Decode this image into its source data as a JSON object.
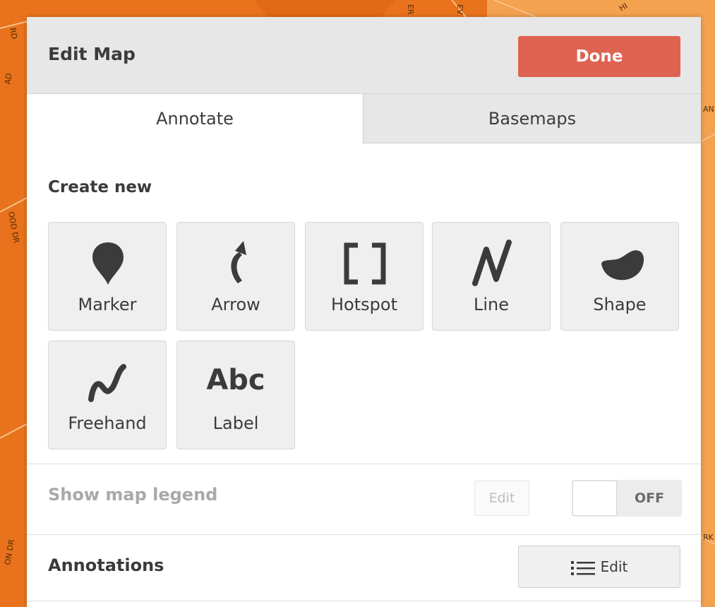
{
  "panel": {
    "title": "Edit Map",
    "done_label": "Done"
  },
  "tabs": [
    {
      "label": "Annotate",
      "active": true
    },
    {
      "label": "Basemaps",
      "active": false
    }
  ],
  "create_new": {
    "heading": "Create new",
    "tools": [
      {
        "label": "Marker",
        "icon": "marker-icon"
      },
      {
        "label": "Arrow",
        "icon": "arrow-icon"
      },
      {
        "label": "Hotspot",
        "icon": "hotspot-icon"
      },
      {
        "label": "Line",
        "icon": "line-icon"
      },
      {
        "label": "Shape",
        "icon": "shape-icon"
      },
      {
        "label": "Freehand",
        "icon": "freehand-icon"
      },
      {
        "label": "Label",
        "icon": "abc-icon",
        "icon_text": "Abc"
      }
    ]
  },
  "legend": {
    "label": "Show map legend",
    "edit_label": "Edit",
    "toggle_state": "OFF"
  },
  "annotations": {
    "label": "Annotations",
    "edit_label": "Edit",
    "edit_icon": "list-icon"
  },
  "map_labels": [
    "RD",
    "AD",
    "OOD DR",
    "ER",
    "EV",
    "HI",
    "AN",
    "RK",
    "ON DR"
  ],
  "colors": {
    "accent_done": "#de6351",
    "map_orange_dark": "#e8731c",
    "map_orange_light": "#f3a24f",
    "icon_gray": "#3b3b3b"
  }
}
